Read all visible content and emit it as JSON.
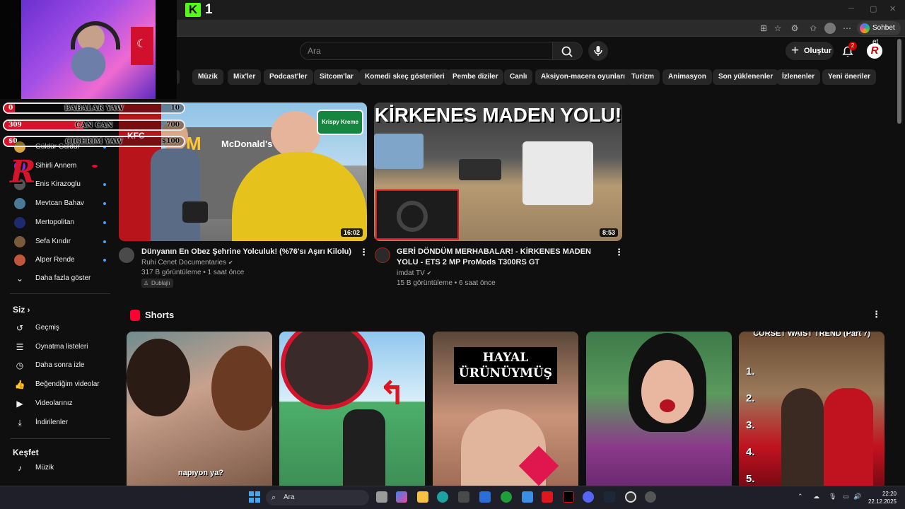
{
  "browser": {
    "kick_count": "1",
    "copilot_label": "Sohbet et"
  },
  "overlay": {
    "goals": [
      {
        "current": "0",
        "label": "BABALAR YAW",
        "target": "10",
        "progress": 0.0
      },
      {
        "current": "309",
        "label": "CAN CAN",
        "target": "700",
        "progress": 0.44
      },
      {
        "current": "$0",
        "label": "CIGERIM YAW",
        "target": "$100",
        "progress": 0.0
      }
    ]
  },
  "header": {
    "search_placeholder": "Ara",
    "create_label": "Oluştur",
    "notification_count": "2",
    "avatar_letter": "R"
  },
  "chips": [
    "n",
    "Müzik",
    "Mix'ler",
    "Podcast'ler",
    "Sitcom'lar",
    "Komedi skeç gösterileri",
    "Pembe diziler",
    "Canlı",
    "Aksiyon-macera oyunları",
    "Turizm",
    "Animasyon",
    "Son yüklenenler",
    "İzlenenler",
    "Yeni öneriler"
  ],
  "sidebar": {
    "subscriptions": [
      {
        "label": "Güldür Güldür",
        "color": "#d9a441"
      },
      {
        "label": "Sihirli Annem",
        "color": "#8a2be2",
        "live": true
      },
      {
        "label": "Enis Kirazoglu",
        "color": "#555555"
      },
      {
        "label": "Mevtcan Bahav",
        "color": "#4a7a9a"
      },
      {
        "label": "Mertopolitan",
        "color": "#1e2a6e"
      },
      {
        "label": "Sefa Kındır",
        "color": "#7a5a3a"
      },
      {
        "label": "Alper Rende",
        "color": "#c0573c"
      }
    ],
    "show_more": "Daha fazla göster",
    "you_header": "Siz",
    "you_items": [
      {
        "label": "Geçmiş",
        "icon": "history-icon"
      },
      {
        "label": "Oynatma listeleri",
        "icon": "playlists-icon"
      },
      {
        "label": "Daha sonra izle",
        "icon": "watch-later-icon"
      },
      {
        "label": "Beğendiğim videolar",
        "icon": "like-icon"
      },
      {
        "label": "Videolarınız",
        "icon": "your-videos-icon"
      },
      {
        "label": "İndirilenler",
        "icon": "download-icon"
      }
    ],
    "explore_header": "Keşfet",
    "explore_items": [
      {
        "label": "Müzik",
        "icon": "music-icon"
      }
    ]
  },
  "videos": [
    {
      "title": "Dünyanın En Obez Şehrine Yolculuk! (%76'sı Aşırı Kilolu)",
      "channel": "Ruhi Cenet Documentaries",
      "meta": "317 B görüntüleme • 1 saat önce",
      "badge": "Dublajlı",
      "duration": "16:02"
    },
    {
      "title": "GERİ DÖNDÜM MERHABALAR! - KİRKENES MADEN YOLU  - ETS 2 MP ProMods T300RS GT",
      "channel": "imdat TV",
      "meta": "15 B görüntüleme • 6 saat önce",
      "duration": "8:53",
      "thumb_text": "KİRKENES MADEN YOLU!"
    }
  ],
  "thumb1_texts": {
    "kfc": "KFC",
    "mcd": "McDonald's",
    "krispy": "Krispy Kreme"
  },
  "shorts": {
    "title": "Shorts",
    "items": [
      {
        "caption": "napıyon ya?"
      },
      {
        "caption": ""
      },
      {
        "caption": "HAYAL ÜRÜNÜYMÜŞ"
      },
      {
        "caption": ""
      },
      {
        "caption": "CORSET WAIST TREND (Part 7)"
      }
    ],
    "short5_numbers": [
      "1.",
      "2.",
      "3.",
      "4.",
      "5."
    ]
  },
  "taskbar": {
    "search_label": "Ara",
    "time": "22:20",
    "date": "22.12.2025"
  }
}
